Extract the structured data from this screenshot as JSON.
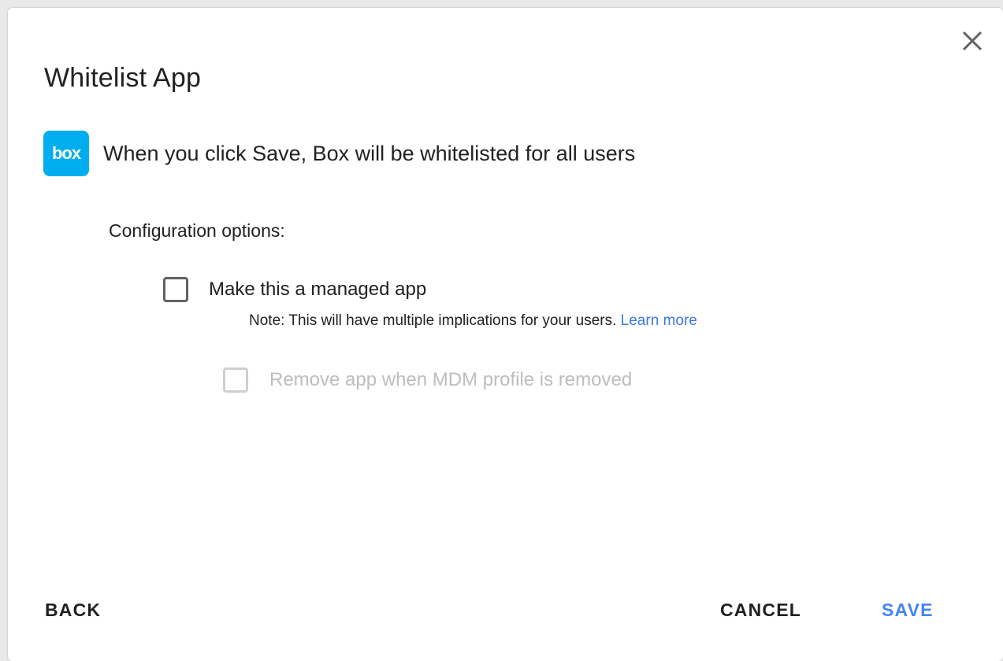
{
  "dialog": {
    "title": "Whitelist App",
    "close_icon": "close-icon"
  },
  "app": {
    "logo_text": "box",
    "logo_color": "#00aeef",
    "message": "When you click Save, Box will be whitelisted for all users"
  },
  "config": {
    "label": "Configuration options:",
    "options": [
      {
        "label": "Make this a managed app",
        "checked": false,
        "disabled": false
      },
      {
        "label": "Remove app when MDM profile is removed",
        "checked": false,
        "disabled": true
      }
    ],
    "note": {
      "text": "Note: This will have multiple implications for your users.",
      "link_text": "Learn more"
    }
  },
  "actions": {
    "back_label": "BACK",
    "cancel_label": "CANCEL",
    "save_label": "SAVE",
    "accent_color": "#4285f4"
  }
}
